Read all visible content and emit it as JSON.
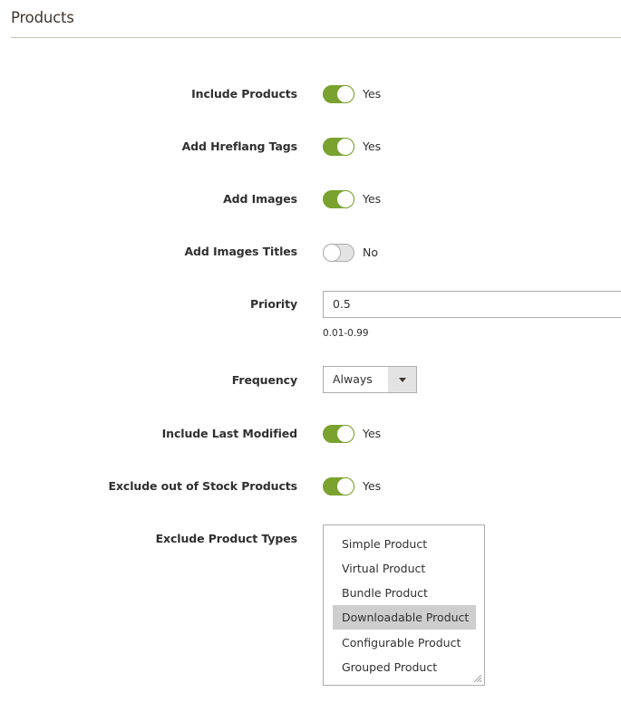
{
  "section": {
    "title": "Products"
  },
  "fields": {
    "include_products": {
      "label": "Include Products",
      "value": "Yes",
      "on": true
    },
    "add_hreflang": {
      "label": "Add Hreflang Tags",
      "value": "Yes",
      "on": true
    },
    "add_images": {
      "label": "Add Images",
      "value": "Yes",
      "on": true
    },
    "add_images_titles": {
      "label": "Add Images Titles",
      "value": "No",
      "on": false
    },
    "priority": {
      "label": "Priority",
      "value": "0.5",
      "note": "0.01-0.99"
    },
    "frequency": {
      "label": "Frequency",
      "value": "Always"
    },
    "include_last_modified": {
      "label": "Include Last Modified",
      "value": "Yes",
      "on": true
    },
    "exclude_out_of_stock": {
      "label": "Exclude out of Stock Products",
      "value": "Yes",
      "on": true
    },
    "exclude_product_types": {
      "label": "Exclude Product Types",
      "options": [
        {
          "label": "Simple Product",
          "selected": false
        },
        {
          "label": "Virtual Product",
          "selected": false
        },
        {
          "label": "Bundle Product",
          "selected": false
        },
        {
          "label": "Downloadable Product",
          "selected": true
        },
        {
          "label": "Configurable Product",
          "selected": false
        },
        {
          "label": "Grouped Product",
          "selected": false
        }
      ]
    }
  },
  "colors": {
    "toggle_on": "#79a22e",
    "toggle_off": "#e3e3e3",
    "selected_option": "#cecece"
  }
}
